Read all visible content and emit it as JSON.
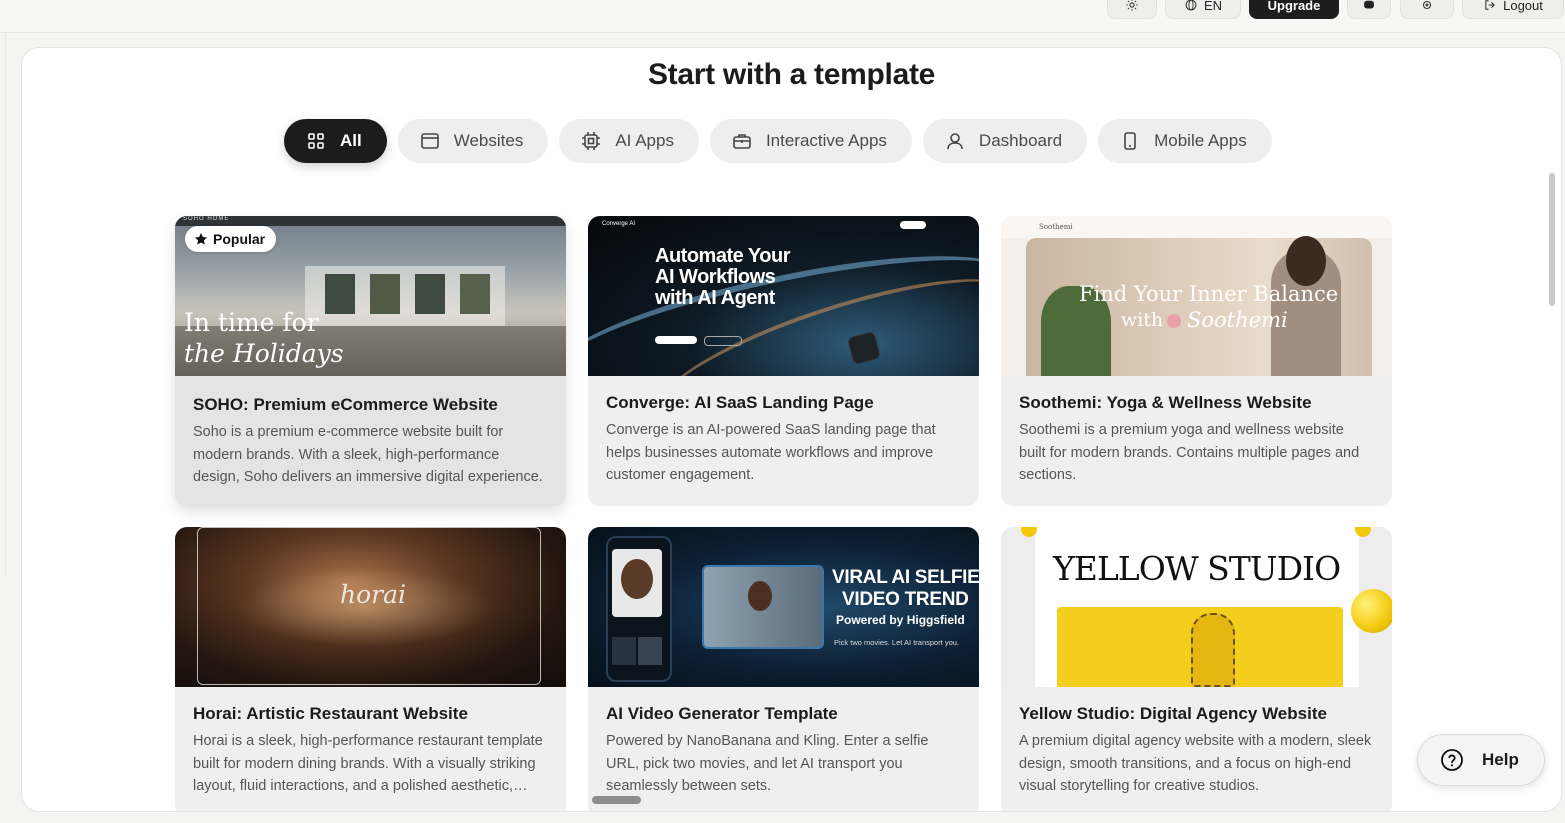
{
  "topbar": {
    "language_label": "EN",
    "upgrade_label": "Upgrade",
    "logout_label": "Logout"
  },
  "main": {
    "title": "Start with a template",
    "tabs": [
      {
        "label": "All",
        "icon": "grid-icon",
        "active": true
      },
      {
        "label": "Websites",
        "icon": "browser-window-icon",
        "active": false
      },
      {
        "label": "AI Apps",
        "icon": "cpu-chip-icon",
        "active": false
      },
      {
        "label": "Interactive Apps",
        "icon": "briefcase-icon",
        "active": false
      },
      {
        "label": "Dashboard",
        "icon": "user-icon",
        "active": false
      },
      {
        "label": "Mobile Apps",
        "icon": "smartphone-icon",
        "active": false
      }
    ],
    "templates": [
      {
        "title": "SOHO: Premium eCommerce Website",
        "description": "Soho is a premium e-commerce website built for modern brands. With a sleek, high-performance design, Soho delivers an immersive digital experience.",
        "badge": "Popular",
        "thumb_text": [
          "In time for",
          "the Holidays"
        ],
        "thumb_brand": "SOHO HOME"
      },
      {
        "title": "Converge: AI SaaS Landing Page",
        "description": "Converge is an AI-powered SaaS landing page that helps businesses automate workflows and improve customer engagement.",
        "thumb_text": [
          "Automate Your",
          "AI Workflows",
          "with AI Agent"
        ],
        "thumb_brand": "Converge AI"
      },
      {
        "title": "Soothemi: Yoga & Wellness Website",
        "description": "Soothemi is a premium yoga and wellness website built for modern brands. Contains multiple pages and sections.",
        "thumb_text": [
          "Find Your Inner Balance",
          "with",
          "Soothemi"
        ],
        "thumb_brand": "Soothemi"
      },
      {
        "title": "Horai: Artistic Restaurant Website",
        "description": "Horai is a sleek, high-performance restaurant template built for modern dining brands. With a visually striking layout, fluid interactions, and a polished aesthetic, Horai elevates every dining experience.",
        "thumb_text": [
          "horai"
        ]
      },
      {
        "title": "AI Video Generator Template",
        "description": "Powered by NanoBanana and Kling. Enter a selfie URL, pick two movies, and let AI transport you seamlessly between sets.",
        "thumb_text": [
          "VIRAL AI SELFIE",
          "VIDEO TREND",
          "Powered by Higgsfield",
          "Pick two movies. Let AI transport you."
        ]
      },
      {
        "title": "Yellow Studio: Digital Agency Website",
        "description": "A premium digital agency website with a modern, sleek design, smooth transitions, and a focus on high-end visual storytelling for creative studios.",
        "thumb_text": [
          "YELLOW STUDIO"
        ]
      }
    ]
  },
  "help": {
    "label": "Help",
    "icon": "question-circle-icon"
  },
  "colors": {
    "active_tab": "#1c1c1c",
    "card_bg": "#efefef",
    "accent_yellow": "#f5cd1d"
  }
}
